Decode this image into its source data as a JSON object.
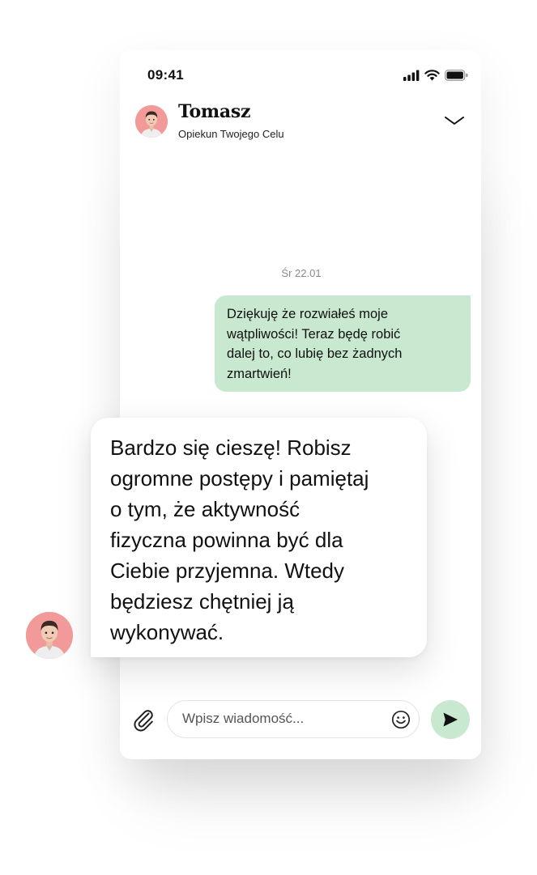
{
  "status_bar": {
    "time": "09:41",
    "icons": [
      "signal-icon",
      "wifi-icon",
      "battery-icon"
    ]
  },
  "header": {
    "name": "Tomasz",
    "subtitle": "Opiekun Twojego Celu",
    "avatar_icon": "avatar",
    "collapse_icon": "chevron-down-icon"
  },
  "chat": {
    "date_label": "Śr 22.01",
    "outgoing_message": {
      "lines": [
        "Dziękuję że rozwiałeś moje",
        "wątpliwości! Teraz będę robić",
        "dalej to, co lubię bez żadnych",
        "zmartwień!"
      ]
    },
    "incoming_message": {
      "lines": [
        "Bardzo się cieszę! Robisz",
        "ogromne postępy i pamiętaj",
        "o tym, że aktywność",
        "fizyczna powinna być dla",
        "Ciebie przyjemna. Wtedy",
        "będziesz chętniej ją",
        "wykonywać."
      ]
    }
  },
  "composer": {
    "placeholder": "Wpisz wiadomość...",
    "value": "",
    "attach_icon": "paperclip-icon",
    "emoji_icon": "smiley-icon",
    "send_icon": "send-icon"
  },
  "colors": {
    "outgoing_bubble": "#c8e8cf",
    "send_button": "#c8e8cf",
    "avatar_background": "#f29a9a",
    "date_text": "#8a8a8a"
  }
}
